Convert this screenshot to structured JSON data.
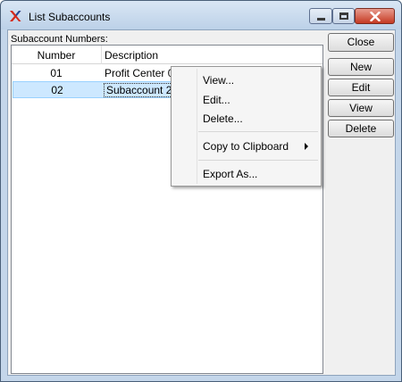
{
  "window": {
    "title": "List Subaccounts",
    "icons": {
      "app": "xtuple-x-icon",
      "minimize": "minimize-icon",
      "maximize": "maximize-icon",
      "close": "close-icon"
    }
  },
  "list": {
    "label": "Subaccount Numbers:",
    "columns": [
      "Number",
      "Description"
    ],
    "rows": [
      {
        "number": "01",
        "description": "Profit Center 0"
      },
      {
        "number": "02",
        "description": "Subaccount 2"
      }
    ],
    "selected_row": "02"
  },
  "buttons": {
    "close": "Close",
    "new": "New",
    "edit": "Edit",
    "view": "View",
    "delete": "Delete"
  },
  "context_menu": {
    "items": [
      "View...",
      "Edit...",
      "Delete...",
      "Copy to Clipboard",
      "Export As..."
    ],
    "submenu_icon": "submenu-arrow-icon"
  },
  "colors": {
    "selection_bg": "#cde8ff",
    "title_bar": "#c4d6ea",
    "close_button": "#c53a23",
    "icon_red": "#d42a1c",
    "icon_blue": "#1f4e9c"
  }
}
